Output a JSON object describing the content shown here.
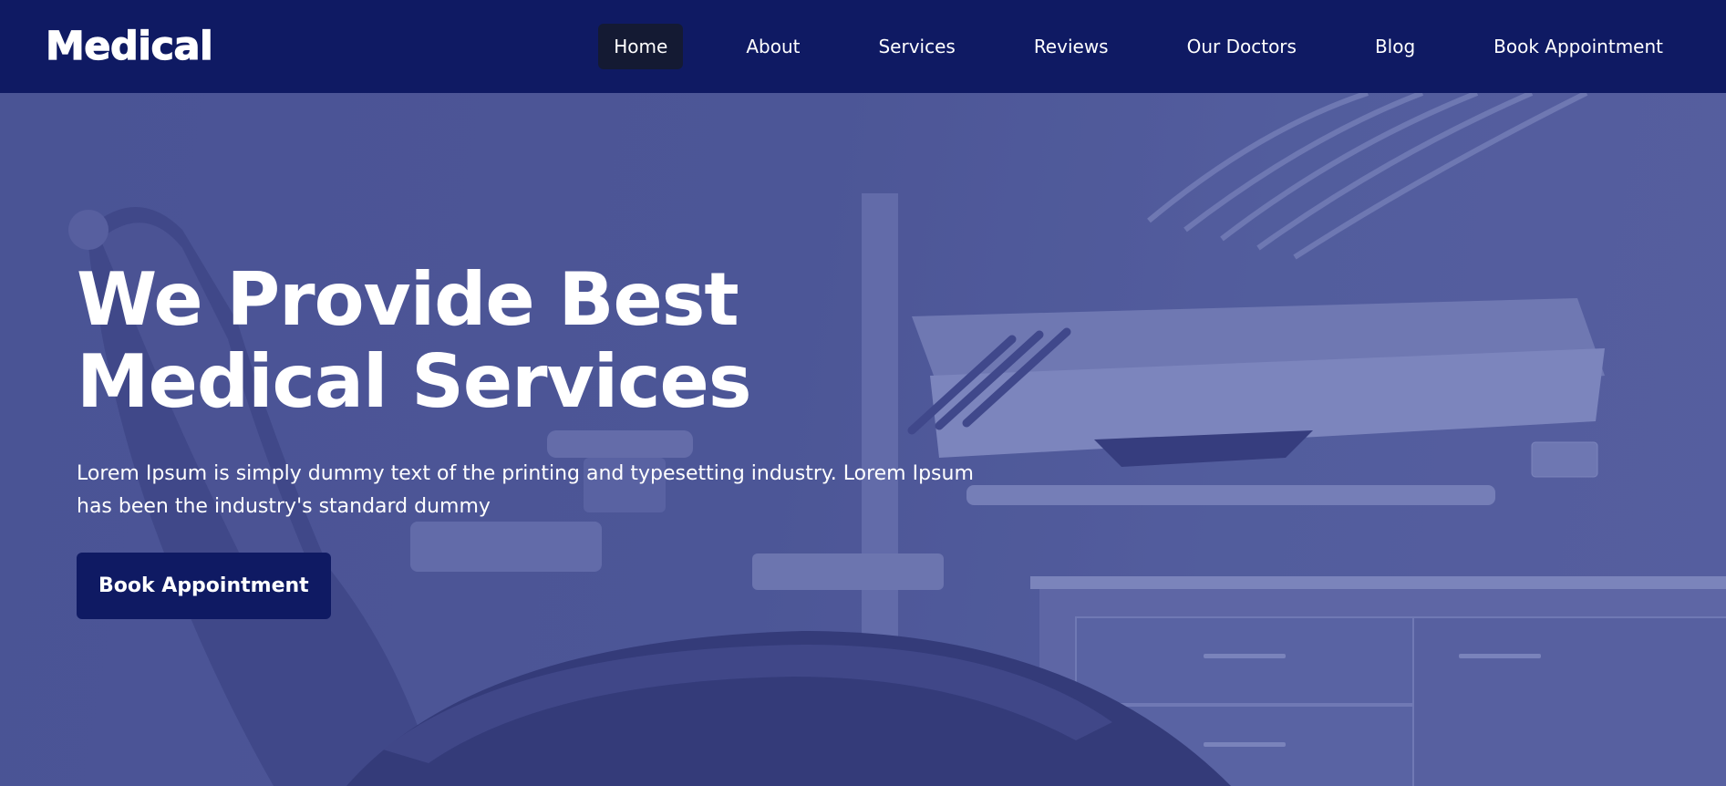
{
  "brand": {
    "logo_text": "Medical"
  },
  "nav": {
    "items": [
      {
        "label": "Home",
        "active": true
      },
      {
        "label": "About"
      },
      {
        "label": "Services"
      },
      {
        "label": "Reviews"
      },
      {
        "label": "Our Doctors"
      },
      {
        "label": "Blog"
      },
      {
        "label": "Book Appointment"
      }
    ]
  },
  "hero": {
    "title_line1": "We Provide Best",
    "title_line2": "Medical Services",
    "description": "Lorem Ipsum is simply dummy text of the printing and typesetting industry. Lorem Ipsum has been the industry's standard dummy",
    "cta_label": "Book Appointment"
  },
  "colors": {
    "nav_bg": "#0f1a63",
    "active_nav_bg": "#141a33",
    "hero_overlay": "#4a5394",
    "button_bg": "#0f1a63",
    "text": "#ffffff"
  }
}
